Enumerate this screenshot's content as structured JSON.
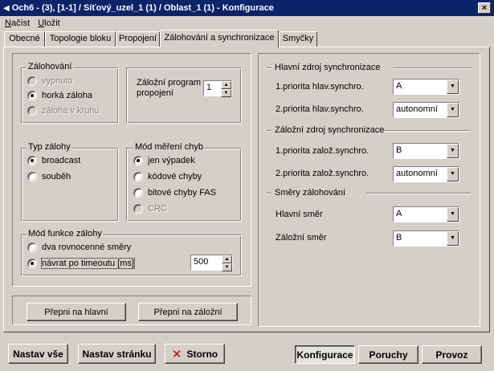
{
  "window": {
    "title": "Och6 - (3), [1-1] / Síťový_uzel_1 (1) / Oblast_1 (1) - Konfigurace",
    "close": "×"
  },
  "menu": [
    {
      "label": "Načíst",
      "mnemonic": "N",
      "rest": "ačíst"
    },
    {
      "label": "Uložit",
      "mnemonic": "U",
      "rest": "ložit"
    }
  ],
  "tabs": [
    "Obecné",
    "Topologie bloku",
    "Propojení",
    "Zálohování a synchronizace",
    "Smyčky"
  ],
  "zalohovani": {
    "title": "Zálohování",
    "options": [
      {
        "label": "vypnuto",
        "checked": false,
        "enabled": false
      },
      {
        "label": "horká záloha",
        "checked": true,
        "enabled": true
      },
      {
        "label": "záloha v kruhu",
        "checked": false,
        "enabled": false
      }
    ]
  },
  "zalozni_program": {
    "label_line1": "Záložní program",
    "label_line2": "propojení",
    "value": "1"
  },
  "typ_zalohy": {
    "title": "Typ zálohy",
    "options": [
      {
        "label": "broadcast",
        "checked": true
      },
      {
        "label": "souběh",
        "checked": false
      }
    ]
  },
  "mod_mereni": {
    "title": "Mód měření chyb",
    "options": [
      {
        "label": "jen výpadek",
        "checked": true,
        "enabled": true
      },
      {
        "label": "kódové chyby",
        "checked": false,
        "enabled": true
      },
      {
        "label": "bitové chyby FAS",
        "checked": false,
        "enabled": true
      },
      {
        "label": "CRC",
        "checked": false,
        "enabled": false
      }
    ]
  },
  "mod_funkce": {
    "title": "Mód funkce zálohy",
    "options": [
      {
        "label": "dva rovnocenné směry",
        "checked": false
      },
      {
        "label": "návrat po timeoutu [ms]",
        "checked": true
      }
    ],
    "timeout": "500"
  },
  "switch_buttons": {
    "main": "Přepni na hlavní",
    "backup": "Přepni na záložní"
  },
  "sync_main": {
    "title": "Hlavní zdroj synchronizace",
    "row1": {
      "label": "1.priorita hlav.synchro.",
      "value": "A"
    },
    "row2": {
      "label": "2.priorita hlav.synchro.",
      "value": "autonomní"
    }
  },
  "sync_backup": {
    "title": "Záložní zdroj synchronizace",
    "row1": {
      "label": "1.priorita založ.synchro.",
      "value": "B"
    },
    "row2": {
      "label": "2.priorita založ.synchro.",
      "value": "autonomní"
    }
  },
  "directions": {
    "title": "Směry zálohování",
    "row1": {
      "label": "Hlavní směr",
      "value": "A"
    },
    "row2": {
      "label": "Záložní směr",
      "value": "B"
    }
  },
  "bottom": {
    "set_all": "Nastav vše",
    "set_page": "Nastav stránku",
    "cancel": "Storno",
    "config": "Konfigurace",
    "faults": "Poruchy",
    "operation": "Provoz"
  }
}
